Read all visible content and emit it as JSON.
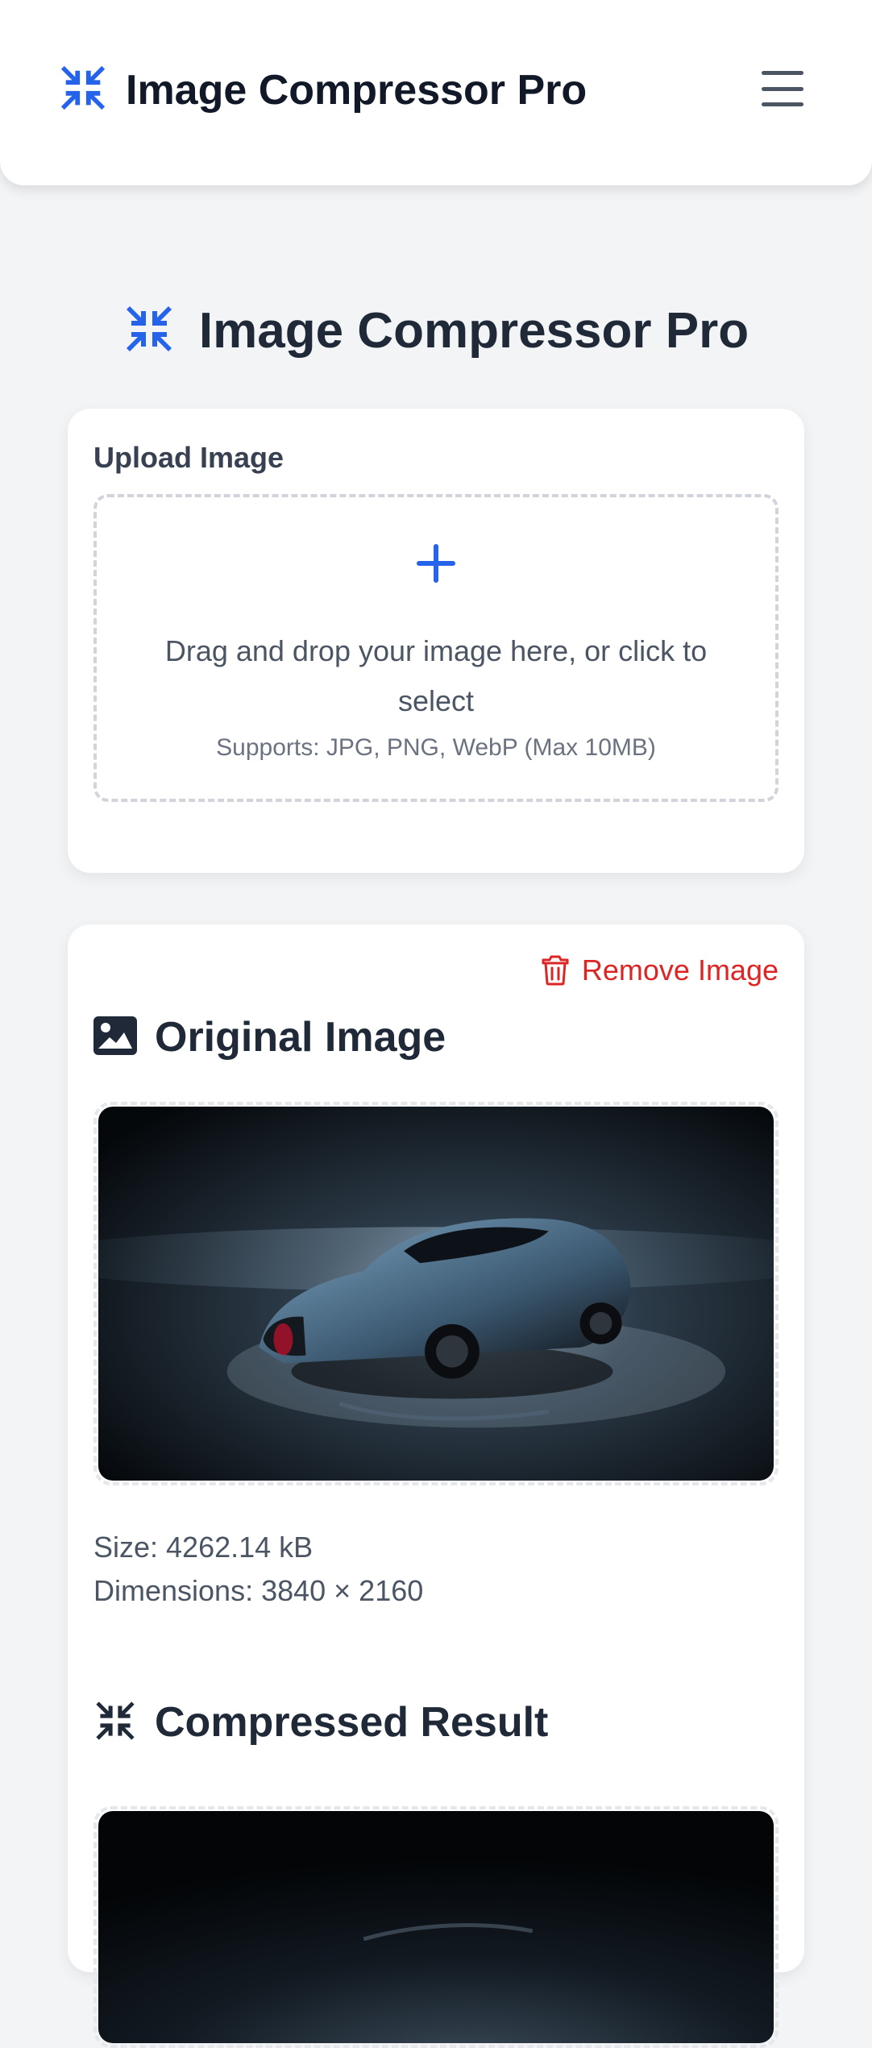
{
  "header": {
    "app_title": "Image Compressor Pro",
    "logo_icon": "compress-icon",
    "menu_icon": "hamburger-menu-icon"
  },
  "page": {
    "title": "Image Compressor Pro",
    "title_icon": "compress-icon"
  },
  "upload": {
    "label": "Upload Image",
    "dropzone_icon": "plus-icon",
    "dropzone_text": "Drag and drop your image here, or click to select",
    "supports_text": "Supports: JPG, PNG, WebP (Max 10MB)"
  },
  "result": {
    "remove_label": "Remove Image",
    "remove_icon": "trash-icon",
    "original": {
      "title": "Original Image",
      "icon": "image-icon",
      "size_text": "Size: 4262.14 kB",
      "dimensions_text": "Dimensions: 3840 × 2160"
    },
    "compressed": {
      "title": "Compressed Result",
      "icon": "compress-icon"
    }
  },
  "colors": {
    "accent": "#2563eb",
    "danger": "#dc2626",
    "background": "#f3f4f6",
    "text": "#1f2937"
  }
}
